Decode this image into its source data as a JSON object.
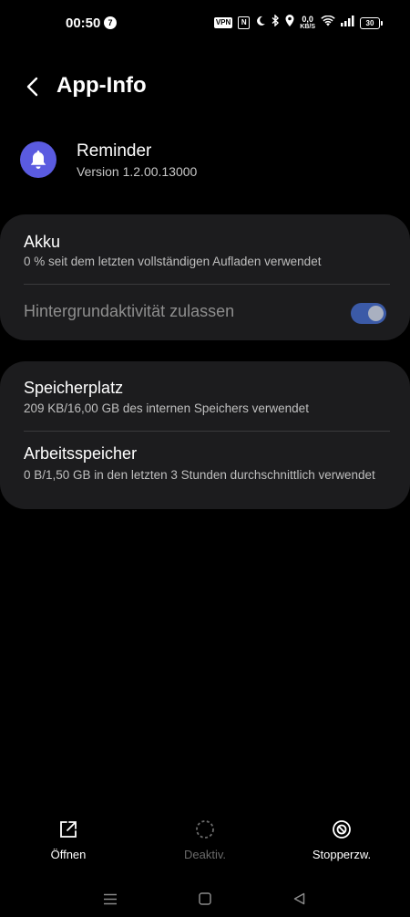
{
  "status_bar": {
    "time": "00:50",
    "notification_count": "7",
    "vpn_label": "VPN",
    "nfc_label": "N",
    "network_speed_value": "0,0",
    "network_speed_unit": "KB/S",
    "battery_level": "30"
  },
  "header": {
    "title": "App-Info",
    "back_icon": "chevron-left-icon"
  },
  "app": {
    "name": "Reminder",
    "version": "Version 1.2.00.13000",
    "icon": "bell-icon",
    "icon_bg_color": "#5a5be0"
  },
  "battery_section": {
    "title": "Akku",
    "subtitle": "0 % seit dem letzten vollständigen Aufladen verwendet",
    "background_activity_label": "Hintergrundaktivität zulassen",
    "background_activity_enabled": true
  },
  "storage_section": {
    "storage_title": "Speicherplatz",
    "storage_subtitle": "209 KB/16,00 GB des internen Speichers verwendet",
    "memory_title": "Arbeitsspeicher",
    "memory_subtitle": "0 B/1,50 GB in den letzten 3 Stunden durchschnittlich verwendet"
  },
  "actions": [
    {
      "label": "Öffnen",
      "icon": "open-external-icon",
      "enabled": true
    },
    {
      "label": "Deaktiv.",
      "icon": "disable-icon",
      "enabled": false
    },
    {
      "label": "Stopperzw.",
      "icon": "force-stop-icon",
      "enabled": true
    }
  ],
  "colors": {
    "background": "#000000",
    "card": "#1c1c1e",
    "accent": "#3b5aa7"
  }
}
